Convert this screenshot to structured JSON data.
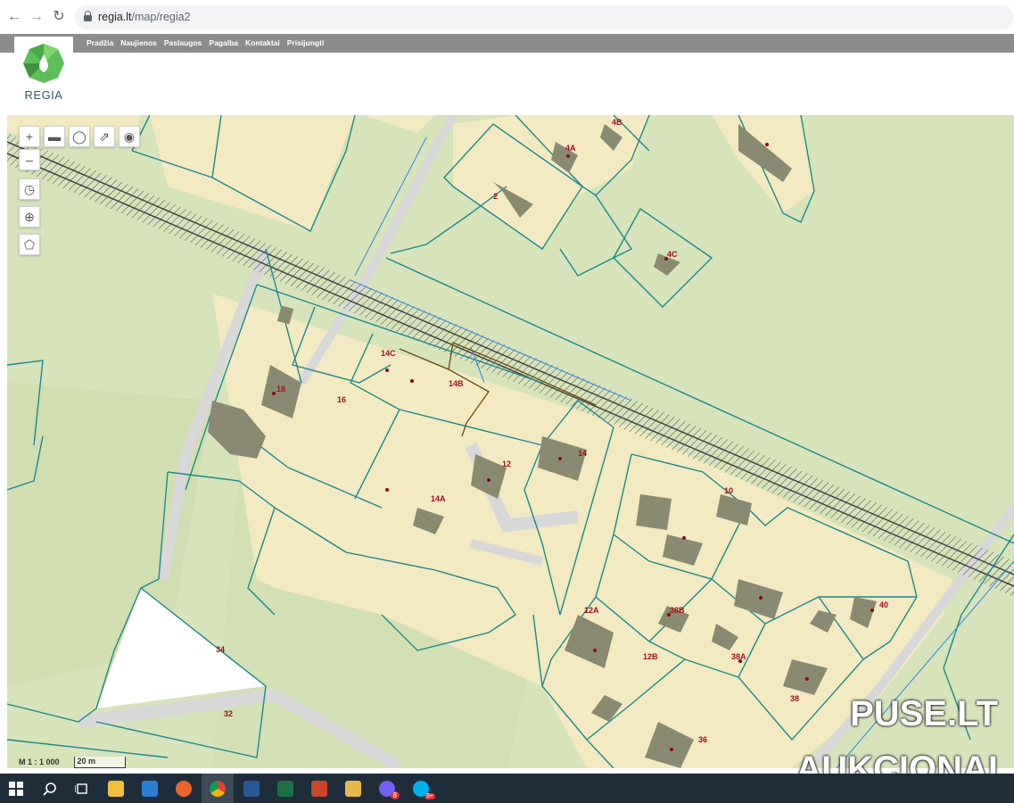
{
  "browser": {
    "url_host": "regia.lt",
    "url_path": "/map/regia2",
    "back_icon": "←",
    "forward_icon": "→",
    "reload_icon": "↻"
  },
  "site": {
    "logo_text": "REGIA",
    "menu": [
      "Pradžia",
      "Naujienos",
      "Paslaugos",
      "Pagalba",
      "Kontaktai",
      "Prisijungti"
    ]
  },
  "map": {
    "tools_top": [
      "zoom-in",
      "measure",
      "marker",
      "export",
      "locate"
    ],
    "tools_left": [
      "zoom-out",
      "compass",
      "crosshair",
      "polygon"
    ],
    "scale_text": "M 1 : 1 000",
    "scalebar_text": "20 m",
    "parcel_labels": [
      {
        "text": "4B"
      },
      {
        "text": "4A"
      },
      {
        "text": "2"
      },
      {
        "text": "4C"
      },
      {
        "text": "14C"
      },
      {
        "text": "14B"
      },
      {
        "text": "18"
      },
      {
        "text": "16"
      },
      {
        "text": "12"
      },
      {
        "text": "14"
      },
      {
        "text": "14A"
      },
      {
        "text": "10"
      },
      {
        "text": "12A"
      },
      {
        "text": "38B"
      },
      {
        "text": "40"
      },
      {
        "text": "12B"
      },
      {
        "text": "38A"
      },
      {
        "text": "38"
      },
      {
        "text": "34"
      },
      {
        "text": "32"
      },
      {
        "text": "36"
      }
    ]
  },
  "watermark": {
    "line1": "PUSE.LT",
    "line2": "AUKCIONAI"
  },
  "taskbar": {
    "apps": [
      "windows-start",
      "search",
      "task-view",
      "file-explorer",
      "store",
      "firefox",
      "chrome",
      "word",
      "excel",
      "powerpoint",
      "mail",
      "viber",
      "skype"
    ],
    "viber_badge": "8",
    "skype_badge": "9+"
  },
  "colors": {
    "parcel_line": "#1a8a8a",
    "parcel_fill": "#f3e9c2",
    "building": "#8a8a72",
    "ground": "#d6e3bb"
  }
}
